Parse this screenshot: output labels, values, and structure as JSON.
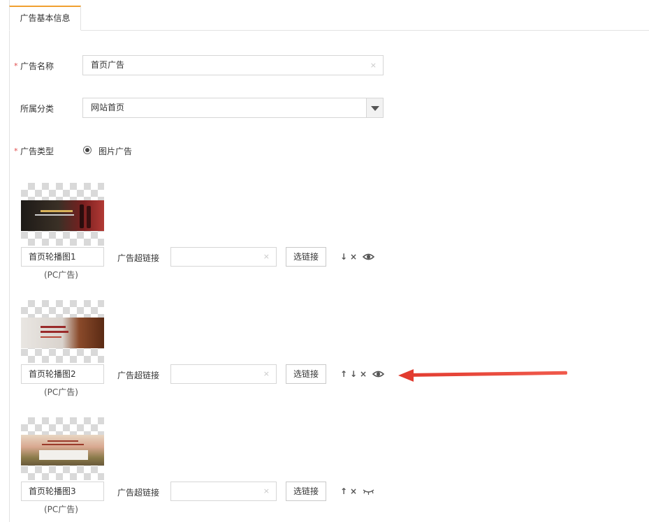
{
  "tab": {
    "label": "广告基本信息"
  },
  "form": {
    "name": {
      "label": "广告名称",
      "value": "首页广告",
      "clear": "×"
    },
    "category": {
      "label": "所属分类",
      "value": "网站首页"
    },
    "type": {
      "label": "广告类型",
      "option": "图片广告"
    },
    "required_mark": "*"
  },
  "items": [
    {
      "name": "首页轮播图1",
      "sub": "(PC广告)",
      "link_label": "广告超链接",
      "link_value": "",
      "clear": "×",
      "select_link": "选链接",
      "actions": [
        "↓",
        "×"
      ],
      "visible": true
    },
    {
      "name": "首页轮播图2",
      "sub": "(PC广告)",
      "link_label": "广告超链接",
      "link_value": "",
      "clear": "×",
      "select_link": "选链接",
      "actions": [
        "↑",
        "↓",
        "×"
      ],
      "visible": true
    },
    {
      "name": "首页轮播图3",
      "sub": "(PC广告)",
      "link_label": "广告超链接",
      "link_value": "",
      "clear": "×",
      "select_link": "选链接",
      "actions": [
        "↑",
        "×"
      ],
      "visible": false
    }
  ],
  "colors": {
    "tab_accent": "#f0a030",
    "required": "#e04c4c",
    "annotation_arrow": "#e23b2f"
  }
}
